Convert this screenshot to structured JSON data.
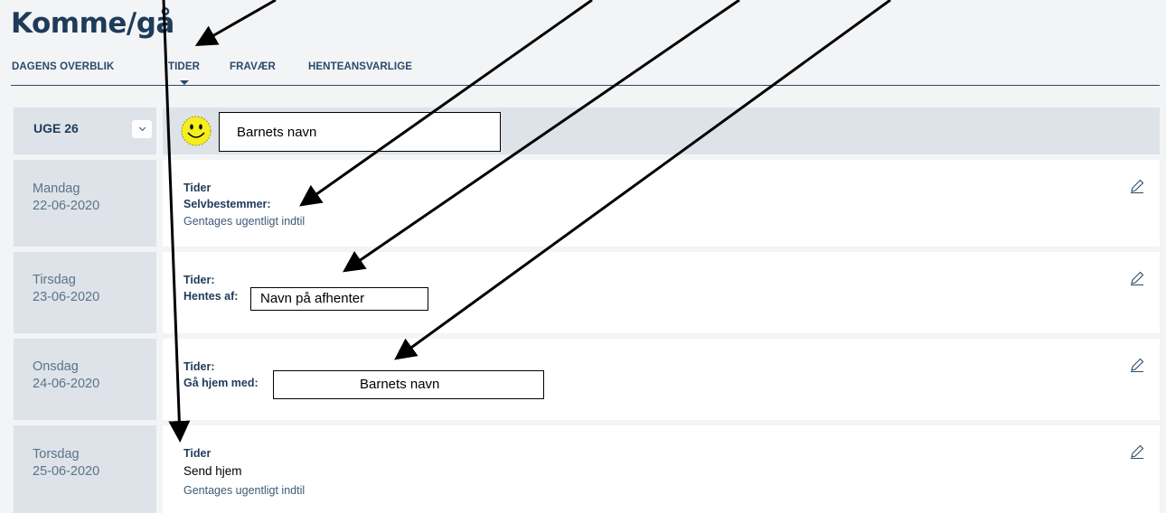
{
  "page": {
    "title": "Komme/gå"
  },
  "tabs": [
    {
      "label": "DAGENS OVERBLIK"
    },
    {
      "label": "TIDER",
      "active": true
    },
    {
      "label": "FRAVÆR"
    },
    {
      "label": "HENTEANSVARLIGE"
    }
  ],
  "week": {
    "label": "UGE 26",
    "toggle_icon": "chevron-down-icon"
  },
  "child": {
    "avatar_icon": "smiley-icon",
    "name_box": "Barnets navn"
  },
  "days": [
    {
      "day": "Mandag",
      "date": "22-06-2020",
      "times_label": "Tider",
      "selv_label": "Selvbestemmer:",
      "repeat_text": "Gentages ugentligt indtil"
    },
    {
      "day": "Tirsdag",
      "date": "23-06-2020",
      "times_label": "Tider:",
      "pickup_label": "Hentes af:",
      "pickup_box": "Navn på afhenter"
    },
    {
      "day": "Onsdag",
      "date": "24-06-2020",
      "times_label": "Tider:",
      "walk_label": "Gå hjem med:",
      "walk_box": "Barnets navn"
    },
    {
      "day": "Torsdag",
      "date": "25-06-2020",
      "times_label": "Tider",
      "send_text": "Send hjem",
      "repeat_text": "Gentages ugentligt indtil"
    }
  ],
  "colors": {
    "accent": "#1f3b5a",
    "panel": "#dde3e8",
    "background": "#f3f4f6",
    "smiley": "#f6ee1c"
  },
  "icons": {
    "edit": "pencil-icon"
  }
}
